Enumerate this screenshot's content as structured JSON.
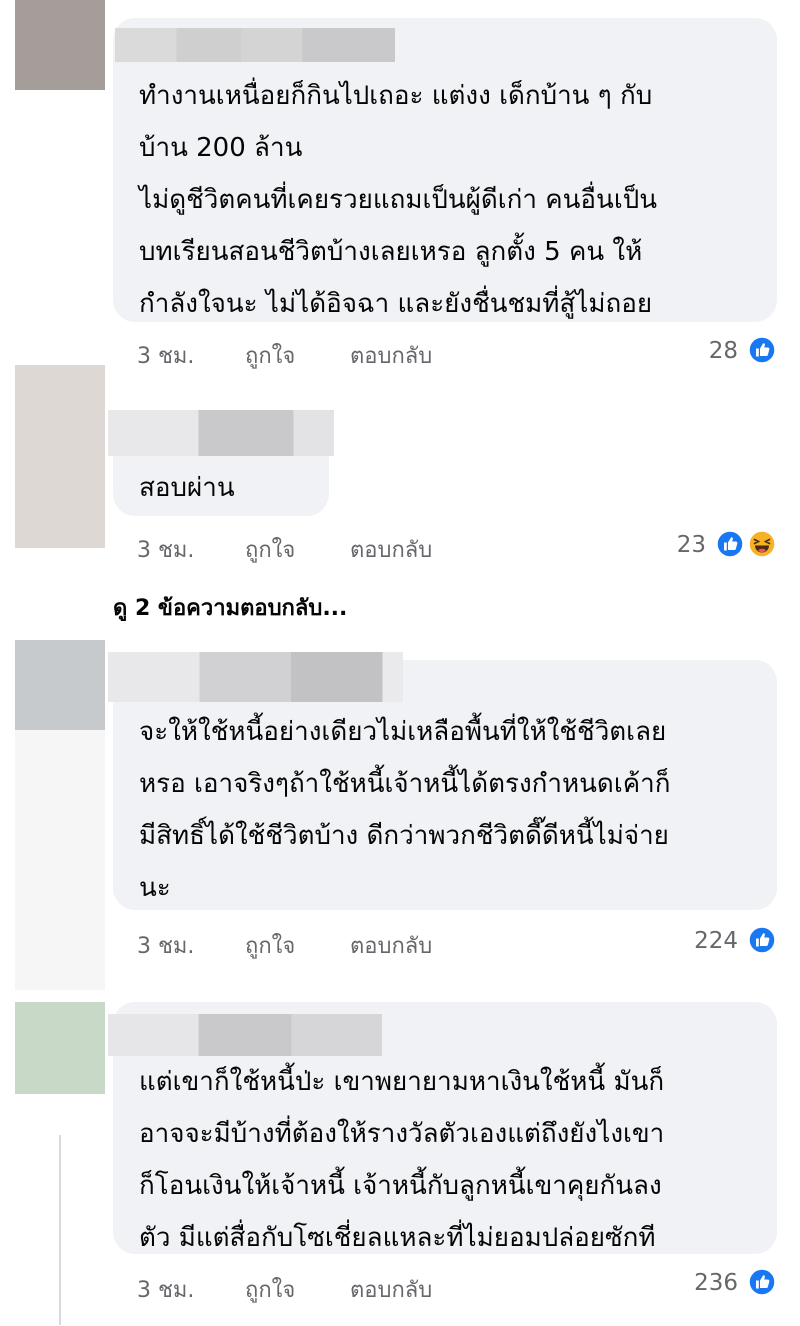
{
  "comments": [
    {
      "lines": [
        "ทำงานเหนื่อยก็กินไปเถอะ แต่งง เด็กบ้าน ๆ กับ",
        "บ้าน 200 ล้าน",
        "ไม่ดูชีวิตคนที่เคยรวยแถมเป็นผู้ดีเก่า คนอื่นเป็น",
        "บทเรียนสอนชีวิตบ้างเลยเหรอ ลูกตั้ง 5 คน ให้",
        "กำลังใจนะ ไม่ได้อิจฉา และยังชื่นชมที่สู้ไม่ถอย"
      ],
      "time": "3 ชม.",
      "like": "ถูกใจ",
      "reply": "ตอบกลับ",
      "count": "28",
      "reactions": [
        "like"
      ]
    },
    {
      "lines": [
        "สอบผ่าน"
      ],
      "time": "3 ชม.",
      "like": "ถูกใจ",
      "reply": "ตอบกลับ",
      "count": "23",
      "reactions": [
        "like",
        "haha"
      ]
    },
    {
      "lines": [
        "จะให้ใช้หนี้อย่างเดียวไม่เหลือพื้นที่ให้ใช้ชีวิตเลย",
        "หรอ เอาจริงๆถ้าใช้หนี้เจ้าหนี้ได้ตรงกำหนดเค้าก็",
        "มีสิทธิ์ได้ใช้ชีวิตบ้าง ดีกว่าพวกชีวิตดี๊ดีหนี้ไม่จ่าย",
        "นะ"
      ],
      "time": "3 ชม.",
      "like": "ถูกใจ",
      "reply": "ตอบกลับ",
      "count": "224",
      "reactions": [
        "like"
      ]
    },
    {
      "lines": [
        "แต่เขาก็ใช้หนี้ป่ะ เขาพยายามหาเงินใช้หนี้ มันก็",
        "อาจจะมีบ้างที่ต้องให้รางวัลตัวเองแต่ถึงยังไงเขา",
        "ก็โอนเงินให้เจ้าหนี้ เจ้าหนี้กับลูกหนี้เขาคุยกันลง",
        "ตัว มีแต่สื่อกับโซเชี่ยลแหละที่ไม่ยอมปล่อยซักที"
      ],
      "time": "3 ชม.",
      "like": "ถูกใจ",
      "reply": "ตอบกลับ",
      "count": "236",
      "reactions": [
        "like"
      ]
    }
  ],
  "view_replies": "ดู 2 ข้อความตอบกลับ...",
  "colors": {
    "bubble": "#f0f2f5",
    "like_blue": "#1877f2",
    "haha_yellow": "#f7b125",
    "meta_gray": "#65676b"
  }
}
